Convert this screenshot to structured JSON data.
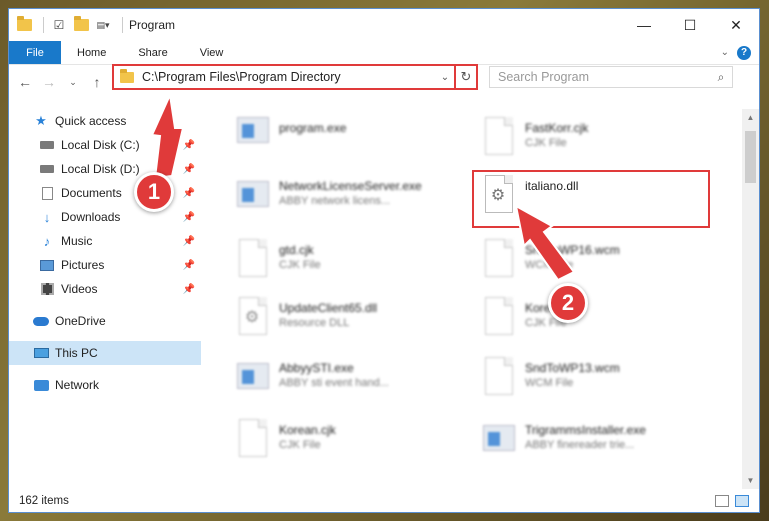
{
  "window": {
    "title": "Program"
  },
  "title_buttons": {
    "minimize": "—",
    "maximize": "☐",
    "close": "✕"
  },
  "ribbon": {
    "tabs": [
      "File",
      "Home",
      "Share",
      "View"
    ]
  },
  "address": {
    "path": "C:\\Program Files\\Program Directory"
  },
  "search": {
    "placeholder": "Search Program"
  },
  "nav": {
    "quick_access": "Quick access",
    "pinned": [
      "Local Disk (C:)",
      "Local Disk (D:)",
      "Documents",
      "Downloads",
      "Music",
      "Pictures",
      "Videos"
    ],
    "onedrive": "OneDrive",
    "this_pc": "This PC",
    "network": "Network"
  },
  "files": {
    "program_exe": {
      "name": "program.exe"
    },
    "fastkorr": {
      "name": "FastKorr.cjk",
      "type": "CJK File"
    },
    "netlic": {
      "name": "NetworkLicenseServer.exe",
      "type": "ABBY network licens..."
    },
    "italiano": {
      "name": "italiano.dll"
    },
    "gtd": {
      "name": "gtd.cjk",
      "type": "CJK File"
    },
    "sndwp16": {
      "name": "SndToWP16.wcm",
      "type": "WCM File"
    },
    "updateclient": {
      "name": "UpdateClient65.dll",
      "type": "Resource DLL"
    },
    "korean_r": {
      "name": "Korean...",
      "type": "CJK File"
    },
    "abbysti": {
      "name": "AbbyySTI.exe",
      "type": "ABBY sti event hand..."
    },
    "sndwp13": {
      "name": "SndToWP13.wcm",
      "type": "WCM File"
    },
    "korean_cjk": {
      "name": "Korean.cjk",
      "type": "CJK File"
    },
    "trigramms": {
      "name": "TrigrammsInstaller.exe",
      "type": "ABBY finereader trie..."
    }
  },
  "status": {
    "count": "162 items"
  },
  "callouts": {
    "one": "1",
    "two": "2"
  },
  "colors": {
    "accent": "#1979ca",
    "highlight": "#e03a3a"
  }
}
